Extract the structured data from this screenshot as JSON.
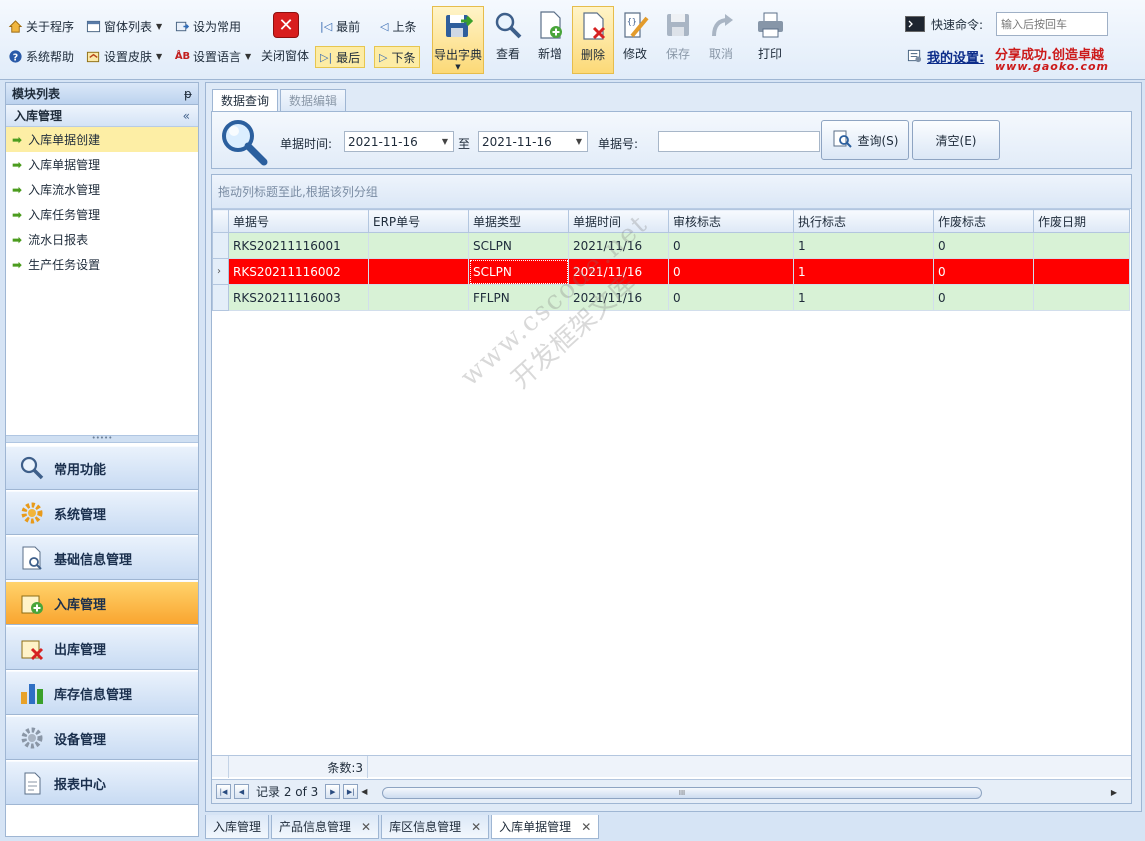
{
  "toolbar": {
    "small": {
      "about": "关于程序",
      "window_list": "窗体列表",
      "set_common": "设为常用",
      "help": "系统帮助",
      "skin": "设置皮肤",
      "language": "设置语言",
      "close_window": "关闭窗体"
    },
    "nav": {
      "first": "最前",
      "prev": "上条",
      "last": "最后",
      "next": "下条"
    },
    "big": {
      "export_dict": "导出字典",
      "view": "查看",
      "add": "新增",
      "delete": "删除",
      "edit": "修改",
      "save": "保存",
      "cancel": "取消",
      "print": "打印"
    },
    "quick_command_label": "快速命令:",
    "quick_command_placeholder": "输入后按回车",
    "my_settings": "我的设置:",
    "slogan": "分享成功.创造卓越",
    "website": "www.gaoko.com"
  },
  "left": {
    "panel_title": "模块列表",
    "pin": "ᵽ",
    "group_title": "入库管理",
    "collapse": "«",
    "menu_items": [
      "入库单据创建",
      "入库单据管理",
      "入库流水管理",
      "入库任务管理",
      "流水日报表",
      "生产任务设置"
    ],
    "splitter_dots": "•••••",
    "nav_groups": [
      "常用功能",
      "系统管理",
      "基础信息管理",
      "入库管理",
      "出库管理",
      "库存信息管理",
      "设备管理",
      "报表中心"
    ]
  },
  "main": {
    "tabs": [
      "数据查询",
      "数据编辑"
    ],
    "query": {
      "time_label": "单据时间:",
      "date_from": "2021-11-16",
      "to_label": "至",
      "date_to": "2021-11-16",
      "doc_label": "单据号:",
      "doc_value": "",
      "query_btn": "查询(S)",
      "clear_btn": "清空(E)"
    },
    "group_hint": "拖动列标题至此,根据该列分组",
    "columns": [
      "单据号",
      "ERP单号",
      "单据类型",
      "单据时间",
      "审核标志",
      "执行标志",
      "作废标志",
      "作废日期"
    ],
    "rows": [
      [
        "RKS20211116001",
        "",
        "SCLPN",
        "2021/11/16",
        "0",
        "1",
        "0",
        ""
      ],
      [
        "RKS20211116002",
        "",
        "SCLPN",
        "2021/11/16",
        "0",
        "1",
        "0",
        ""
      ],
      [
        "RKS20211116003",
        "",
        "FFLPN",
        "2021/11/16",
        "0",
        "1",
        "0",
        ""
      ]
    ],
    "row_indicator": "›",
    "count_text": "条数:3",
    "record_text": "记录 2 of 3",
    "scroll_grip": "III"
  },
  "doc_tabs": [
    "入库管理",
    "产品信息管理",
    "库区信息管理",
    "入库单据管理"
  ],
  "watermark": {
    "line1": "www.cscode.net",
    "line2": "开发框架文库"
  },
  "colors": {
    "selected_row": "#ff0000",
    "row_bg": "#d8f2d6",
    "active_nav": "#f9a530",
    "highlight": "#fdeca5"
  }
}
